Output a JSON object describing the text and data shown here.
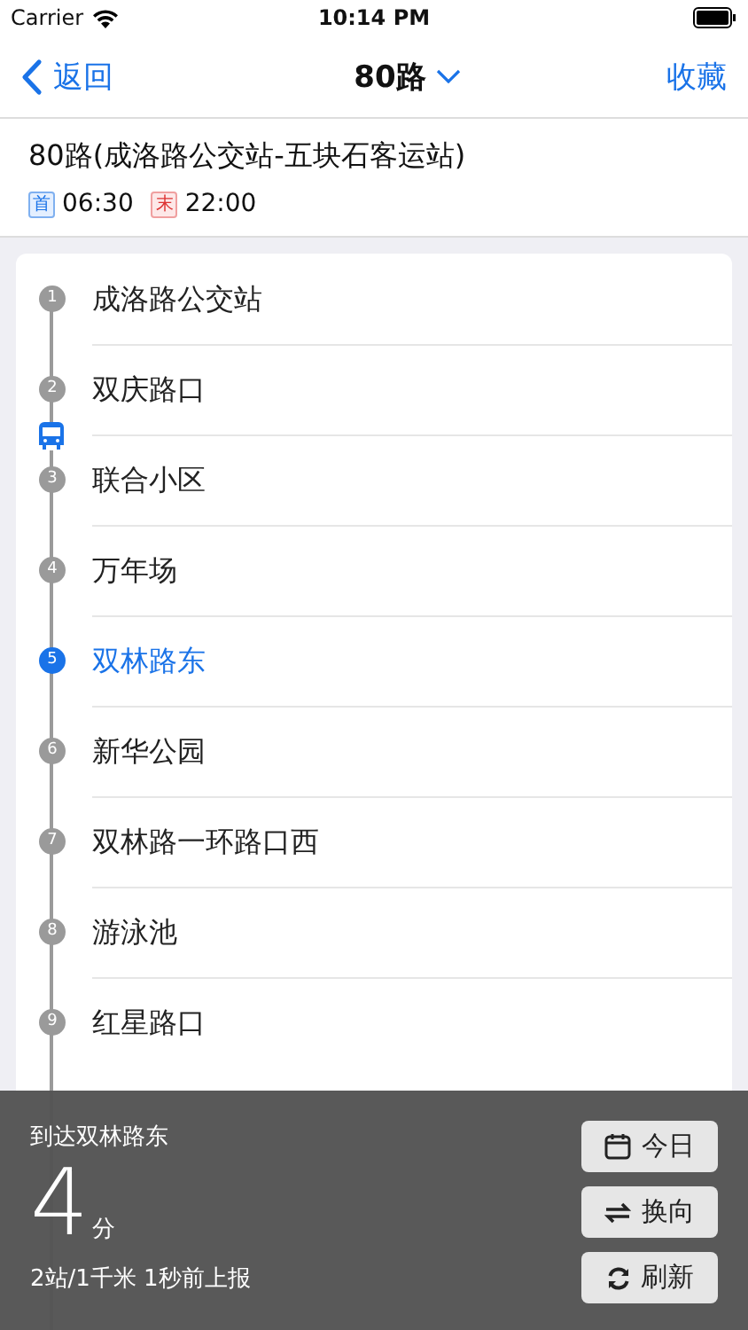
{
  "status_bar": {
    "carrier": "Carrier",
    "time": "10:14 PM"
  },
  "nav": {
    "back": "返回",
    "title": "80路",
    "action": "收藏"
  },
  "route": {
    "name": "80路(成洛路公交站-五块石客运站)",
    "first_label": "首",
    "first_time": "06:30",
    "last_label": "末",
    "last_time": "22:00"
  },
  "stations": [
    {
      "number": "1",
      "name": "成洛路公交站",
      "selected": false,
      "bus_after": false
    },
    {
      "number": "2",
      "name": "双庆路口",
      "selected": false,
      "bus_after": true
    },
    {
      "number": "3",
      "name": "联合小区",
      "selected": false,
      "bus_after": false
    },
    {
      "number": "4",
      "name": "万年场",
      "selected": false,
      "bus_after": false
    },
    {
      "number": "5",
      "name": "双林路东",
      "selected": true,
      "bus_after": false
    },
    {
      "number": "6",
      "name": "新华公园",
      "selected": false,
      "bus_after": false
    },
    {
      "number": "7",
      "name": "双林路一环路口西",
      "selected": false,
      "bus_after": false
    },
    {
      "number": "8",
      "name": "游泳池",
      "selected": false,
      "bus_after": false
    },
    {
      "number": "9",
      "name": "红星路口",
      "selected": false,
      "bus_after": false
    }
  ],
  "arrival": {
    "destination": "到达双林路东",
    "minutes": "4",
    "unit": "分",
    "detail": "2站/1千米 1秒前上报",
    "buttons": [
      {
        "kind": "calendar",
        "label": "今日"
      },
      {
        "kind": "swap",
        "label": "换向"
      },
      {
        "kind": "refresh",
        "label": "刷新"
      }
    ]
  }
}
